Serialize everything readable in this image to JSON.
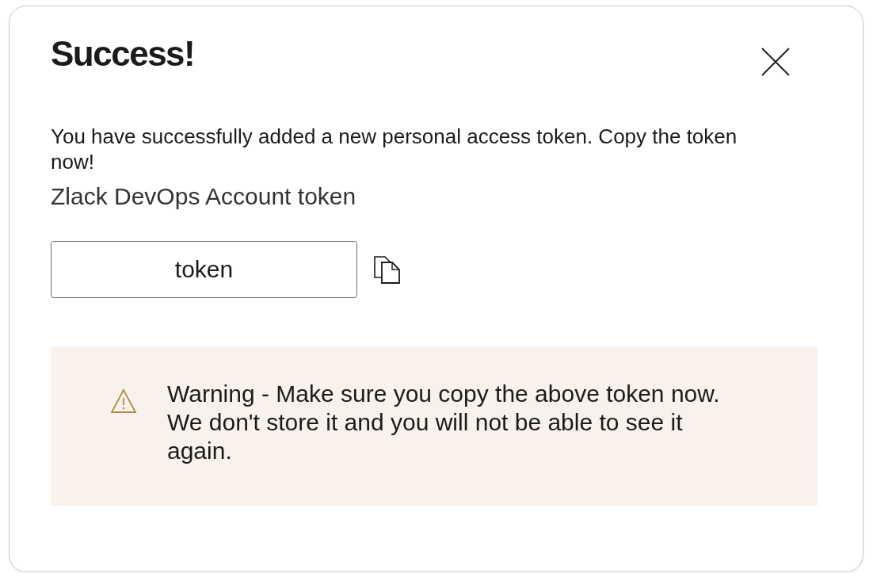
{
  "dialog": {
    "title": "Success!",
    "message": "You have successfully added a new personal access token. Copy the token now!",
    "token_name": "Zlack DevOps Account token",
    "token_field": {
      "value": "token"
    },
    "warning": {
      "text": "Warning - Make sure you copy the above token now. We don't store it and you will not be able to see it again."
    }
  }
}
